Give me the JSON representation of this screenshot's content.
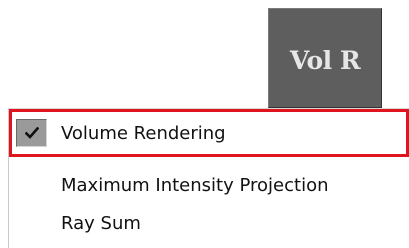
{
  "vol_button": {
    "label": "Vol R"
  },
  "menu": {
    "items": [
      {
        "label": "Volume Rendering",
        "checked": true,
        "highlighted": true
      },
      {
        "label": "Maximum Intensity Projection",
        "checked": false
      },
      {
        "label": "Ray Sum",
        "checked": false
      }
    ]
  },
  "icons": {
    "check": "check-mark-icon"
  },
  "colors": {
    "highlight_border": "#e0141e",
    "button_background": "#5e5e5e",
    "check_background": "#9a9a9a"
  }
}
